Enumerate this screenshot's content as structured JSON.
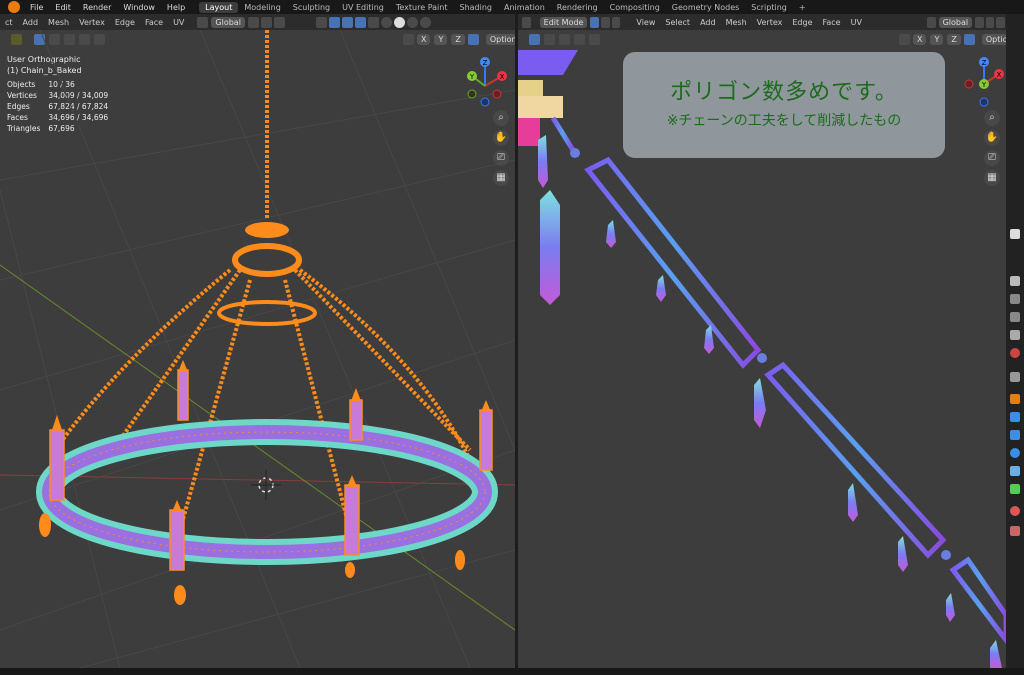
{
  "menubar": {
    "menus": [
      "File",
      "Edit",
      "Render",
      "Window",
      "Help"
    ],
    "workspaces": [
      "Layout",
      "Modeling",
      "Sculpting",
      "UV Editing",
      "Texture Paint",
      "Shading",
      "Animation",
      "Rendering",
      "Compositing",
      "Geometry Nodes",
      "Scripting"
    ],
    "active_workspace": "Layout",
    "add_tab": "+"
  },
  "left": {
    "header": {
      "edge_label": "ct",
      "menus": [
        "Add",
        "Mesh",
        "Vertex",
        "Edge",
        "Face",
        "UV"
      ],
      "orientation": "Global",
      "options": "Options",
      "axes": [
        "X",
        "Y",
        "Z"
      ]
    },
    "overlay": {
      "view_name": "User Orthographic",
      "object_name": "(1) Chain_b_Baked",
      "stats": [
        {
          "label": "Objects",
          "value": "10 / 36"
        },
        {
          "label": "Vertices",
          "value": "34,009 / 34,009"
        },
        {
          "label": "Edges",
          "value": "67,824 / 67,824"
        },
        {
          "label": "Faces",
          "value": "34,696 / 34,696"
        },
        {
          "label": "Triangles",
          "value": "67,696"
        }
      ]
    },
    "gizmo": {
      "x": "X",
      "y": "Y",
      "z": "Z"
    }
  },
  "right": {
    "header": {
      "mode": "Edit Mode",
      "menus": [
        "View",
        "Select",
        "Add",
        "Mesh",
        "Vertex",
        "Edge",
        "Face",
        "UV"
      ],
      "orientation": "Global",
      "options": "Options",
      "axes": [
        "X",
        "Y",
        "Z"
      ]
    },
    "callout": {
      "line1": "ポリゴン数多めです。",
      "line2": "※チェーンの工夫をして削減したもの"
    },
    "gizmo": {
      "x": "X",
      "y": "Y",
      "z": "Z"
    }
  },
  "colors": {
    "accent": "#4772b3",
    "selection_orange": "#ff8c1a",
    "callout_bg": "#8f979c",
    "callout_text": "#1c6b1c",
    "viewport_bg": "#3d3d3d"
  }
}
